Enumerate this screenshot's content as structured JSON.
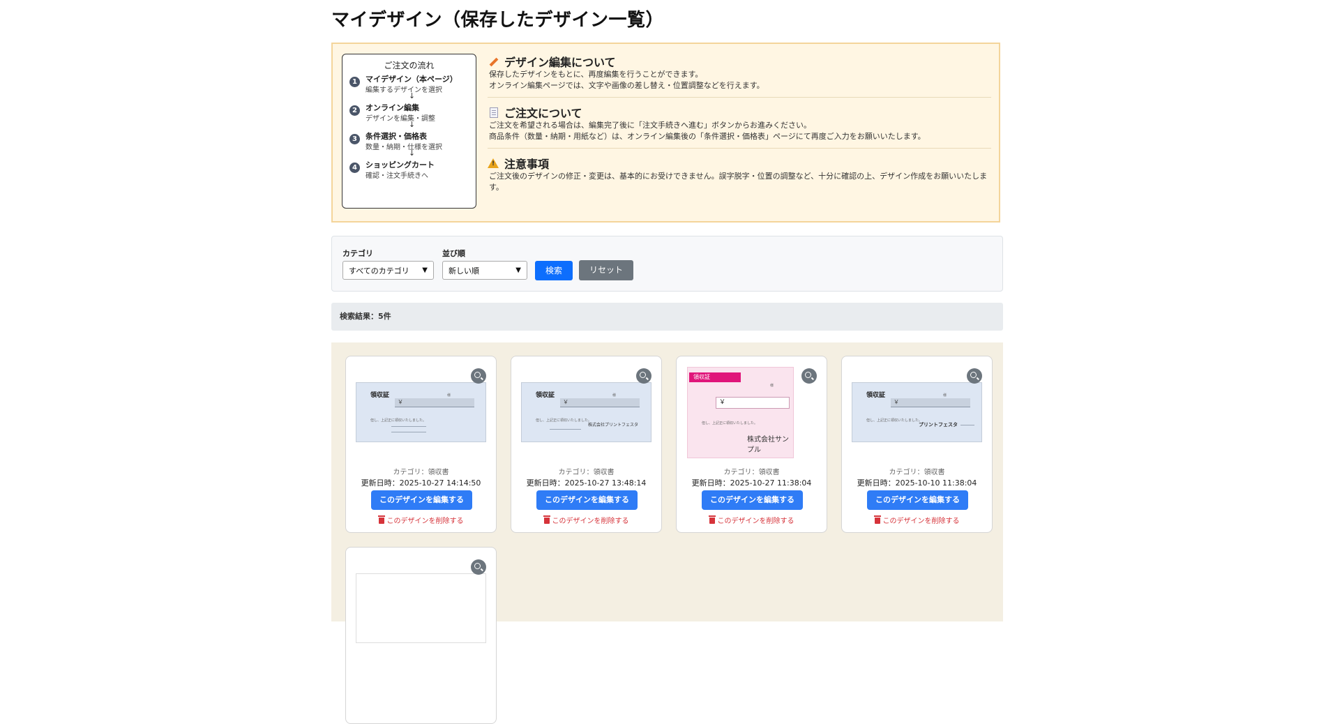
{
  "page_title": "マイデザイン（保存したデザイン一覧）",
  "flow": {
    "title": "ご注文の流れ",
    "arrow": "↓",
    "steps": [
      {
        "num": "1",
        "name": "マイデザイン（本ページ）",
        "desc": "編集するデザインを選択"
      },
      {
        "num": "2",
        "name": "オンライン編集",
        "desc": "デザインを編集・調整"
      },
      {
        "num": "3",
        "name": "条件選択・価格表",
        "desc": "数量・納期・仕様を選択"
      },
      {
        "num": "4",
        "name": "ショッピングカート",
        "desc": "確認・注文手続きへ"
      }
    ]
  },
  "sections": [
    {
      "icon": "pencil-icon",
      "title": "デザイン編集について",
      "lines": [
        "保存したデザインをもとに、再度編集を行うことができます。",
        "オンライン編集ページでは、文字や画像の差し替え・位置調整などを行えます。"
      ]
    },
    {
      "icon": "document-icon",
      "title": "ご注文について",
      "lines": [
        "ご注文を希望される場合は、編集完了後に「注文手続きへ進む」ボタンからお進みください。",
        "商品条件（数量・納期・用紙など）は、オンライン編集後の「条件選択・価格表」ページにて再度ご入力をお願いいたします。"
      ]
    },
    {
      "icon": "warning-icon",
      "title": "注意事項",
      "lines": [
        "ご注文後のデザインの修正・変更は、基本的にお受けできません。誤字脱字・位置の調整など、十分に確認の上、デザイン作成をお願いいたします。"
      ]
    }
  ],
  "filter": {
    "category_label": "カテゴリ",
    "category_value": "すべてのカテゴリ",
    "sort_label": "並び順",
    "sort_value": "新しい順",
    "search_button": "検索",
    "reset_button": "リセット"
  },
  "result_text": "検索結果：5件",
  "cards": [
    {
      "style": "blue",
      "thumb_title": "領収証",
      "thumb_company": "",
      "category": "カテゴリ：領収書",
      "updated": "更新日時：2025-10-27 14:14:50",
      "edit_label": "このデザインを編集する",
      "delete_label": "このデザインを削除する"
    },
    {
      "style": "blue",
      "thumb_title": "領収証",
      "thumb_company": "株式会社プリントフェスタ",
      "category": "カテゴリ：領収書",
      "updated": "更新日時：2025-10-27 13:48:14",
      "edit_label": "このデザインを編集する",
      "delete_label": "このデザインを削除する"
    },
    {
      "style": "pink",
      "thumb_title": "領収証",
      "thumb_company": "株式会社サンプル",
      "category": "カテゴリ：領収書",
      "updated": "更新日時：2025-10-27 11:38:04",
      "edit_label": "このデザインを編集する",
      "delete_label": "このデザインを削除する"
    },
    {
      "style": "blue",
      "thumb_title": "領収証",
      "thumb_company": "プリントフェスタ",
      "category": "カテゴリ：領収書",
      "updated": "更新日時：2025-10-10 11:38:04",
      "edit_label": "このデザインを編集する",
      "delete_label": "このデザインを削除する"
    },
    {
      "style": "blank",
      "thumb_title": "",
      "thumb_company": "",
      "category": "",
      "updated": "",
      "edit_label": "",
      "delete_label": ""
    }
  ],
  "thumb_texts": {
    "yen": "￥",
    "sama": "様",
    "body": "但し、上記正に領収いたしました。"
  }
}
